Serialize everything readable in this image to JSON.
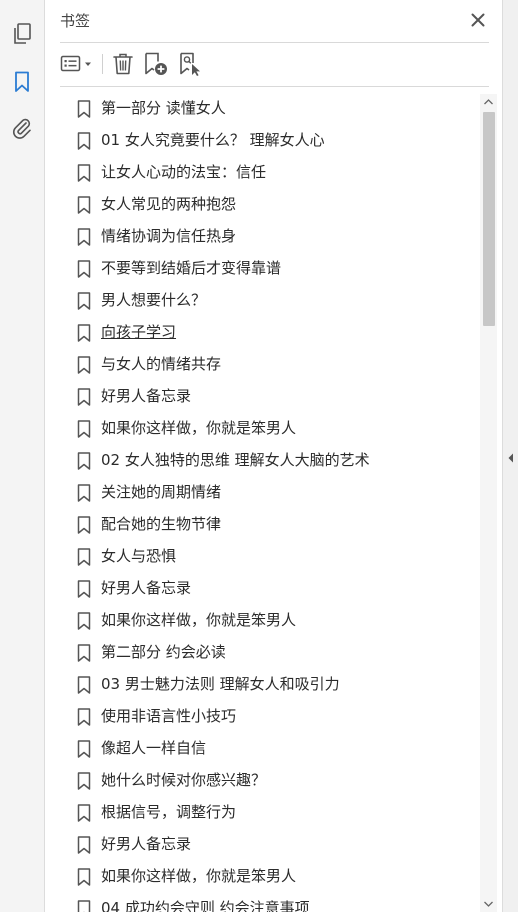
{
  "panel": {
    "title": "书签"
  },
  "rail": {
    "icons": [
      "pages-icon",
      "bookmark-icon",
      "attachment-icon"
    ],
    "active": "bookmark-icon",
    "accent_color": "#2b7cd3"
  },
  "toolbar": {
    "buttons": [
      "options-menu-icon",
      "delete-icon",
      "new-bookmark-icon",
      "bookmark-from-selection-icon"
    ]
  },
  "bookmarks": [
    "第一部分  读懂女人",
    "01  女人究竟要什么？  理解女人心",
    "让女人心动的法宝：信任",
    "女人常见的两种抱怨",
    "情绪协调为信任热身",
    "不要等到结婚后才变得靠谱",
    "男人想要什么？",
    "向孩子学习",
    "与女人的情绪共存",
    "好男人备忘录",
    "如果你这样做，你就是笨男人",
    "02  女人独特的思维  理解女人大脑的艺术",
    "关注她的周期情绪",
    "配合她的生物节律",
    "女人与恐惧",
    "好男人备忘录",
    "如果你这样做，你就是笨男人",
    "第二部分  约会必读",
    "03  男士魅力法则  理解女人和吸引力",
    "使用非语言性小技巧",
    "像超人一样自信",
    "她什么时候对你感兴趣？",
    "根据信号，调整行为",
    "好男人备忘录",
    "如果你这样做，你就是笨男人",
    "04  成功约会守则  约会注意事项"
  ],
  "selected_index": 7
}
